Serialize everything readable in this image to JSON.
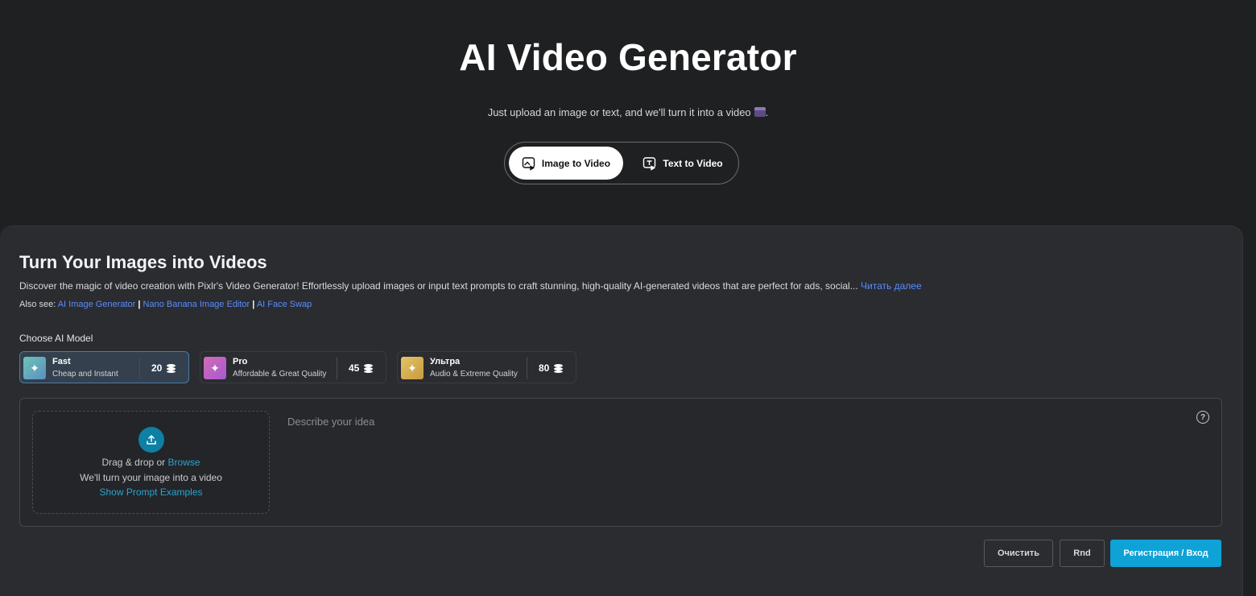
{
  "hero": {
    "title": "AI Video Generator",
    "subtitle": "Just upload an image or text, and we'll turn it into a video",
    "subtitle_end": ".",
    "tabs": [
      {
        "label": "Image to Video",
        "icon": "image-to-video-icon",
        "active": true
      },
      {
        "label": "Text to Video",
        "icon": "text-to-video-icon",
        "active": false
      }
    ]
  },
  "panel": {
    "title": "Turn Your Images into Videos",
    "description": "Discover the magic of video creation with Pixlr's Video Generator! Effortlessly upload images or input text prompts to craft stunning, high-quality AI-generated videos that are perfect for ads, social... ",
    "read_more": "Читать далее",
    "also_see_label": "Also see: ",
    "also_see_links": [
      "AI Image Generator",
      "Nano Banana Image Editor",
      "AI Face Swap"
    ],
    "separator": "|",
    "choose_model_label": "Choose AI Model",
    "models": [
      {
        "name": "Fast",
        "subtitle": "Cheap and Instant",
        "cost": "20",
        "selected": true,
        "color": "#5fb3b0"
      },
      {
        "name": "Pro",
        "subtitle": "Affordable & Great Quality",
        "cost": "45",
        "selected": false,
        "color": "#c45fc0"
      },
      {
        "name": "Ультра",
        "subtitle": "Audio & Extreme Quality",
        "cost": "80",
        "selected": false,
        "color": "#d8b150"
      }
    ]
  },
  "upload": {
    "line1_prefix": "Drag & drop or ",
    "browse": "Browse",
    "line2": "We'll turn your image into a video",
    "examples": "Show Prompt Examples"
  },
  "prompt": {
    "placeholder": "Describe your idea",
    "value": ""
  },
  "actions": {
    "clear": "Очистить",
    "rnd": "Rnd",
    "login": "Регистрация / Вход"
  },
  "colors": {
    "accent": "#0ea2d6",
    "link": "#5b8cff",
    "background": "#1f2022",
    "panel": "#2a2c30"
  }
}
